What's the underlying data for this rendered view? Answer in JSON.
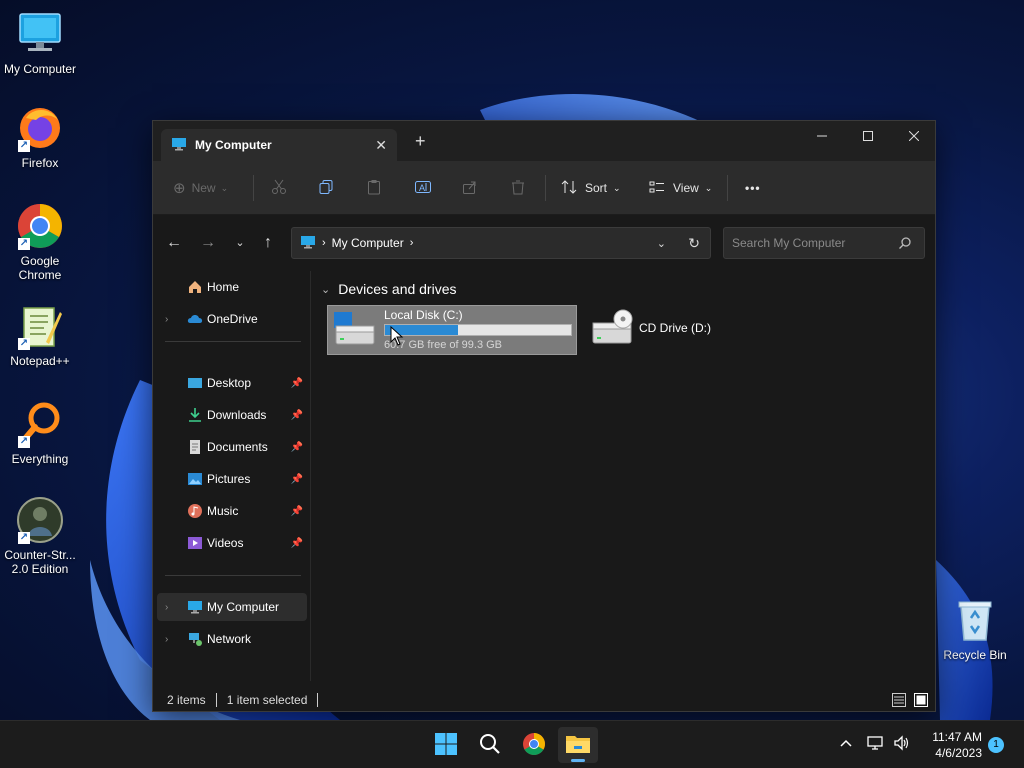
{
  "desktop": {
    "icons": [
      {
        "label": "My Computer",
        "icon": "computer-icon"
      },
      {
        "label": "Firefox",
        "icon": "firefox-icon"
      },
      {
        "label": "Google Chrome",
        "icon": "chrome-icon"
      },
      {
        "label": "Notepad++",
        "icon": "notepadpp-icon"
      },
      {
        "label": "Everything",
        "icon": "everything-icon"
      },
      {
        "label": "Counter-Str... 2.0 Edition",
        "icon": "counter-strike-icon"
      },
      {
        "label": "Recycle Bin",
        "icon": "recycle-bin-icon"
      }
    ]
  },
  "window": {
    "tab_title": "My Computer",
    "toolbar": {
      "new_label": "New",
      "sort_label": "Sort",
      "view_label": "View",
      "more_label": "•••"
    },
    "address": {
      "crumb": "My Computer",
      "search_placeholder": "Search My Computer"
    },
    "sidebar": {
      "home": "Home",
      "onedrive": "OneDrive",
      "desktop": "Desktop",
      "downloads": "Downloads",
      "documents": "Documents",
      "pictures": "Pictures",
      "music": "Music",
      "videos": "Videos",
      "my_computer": "My Computer",
      "network": "Network"
    },
    "content": {
      "group_title": "Devices and drives",
      "drives": [
        {
          "name": "Local Disk (C:)",
          "free_text": "60.7 GB free of 99.3 GB",
          "used_fraction": 0.39
        },
        {
          "name": "CD Drive (D:)"
        }
      ]
    },
    "status": {
      "items": "2 items",
      "selected": "1 item selected"
    }
  },
  "taskbar": {
    "time": "11:47 AM",
    "date": "4/6/2023",
    "notification_count": "1"
  },
  "colors": {
    "accent": "#2a8ad4",
    "window_bg": "#191919",
    "toolbar_bg": "#2c2c2c"
  }
}
